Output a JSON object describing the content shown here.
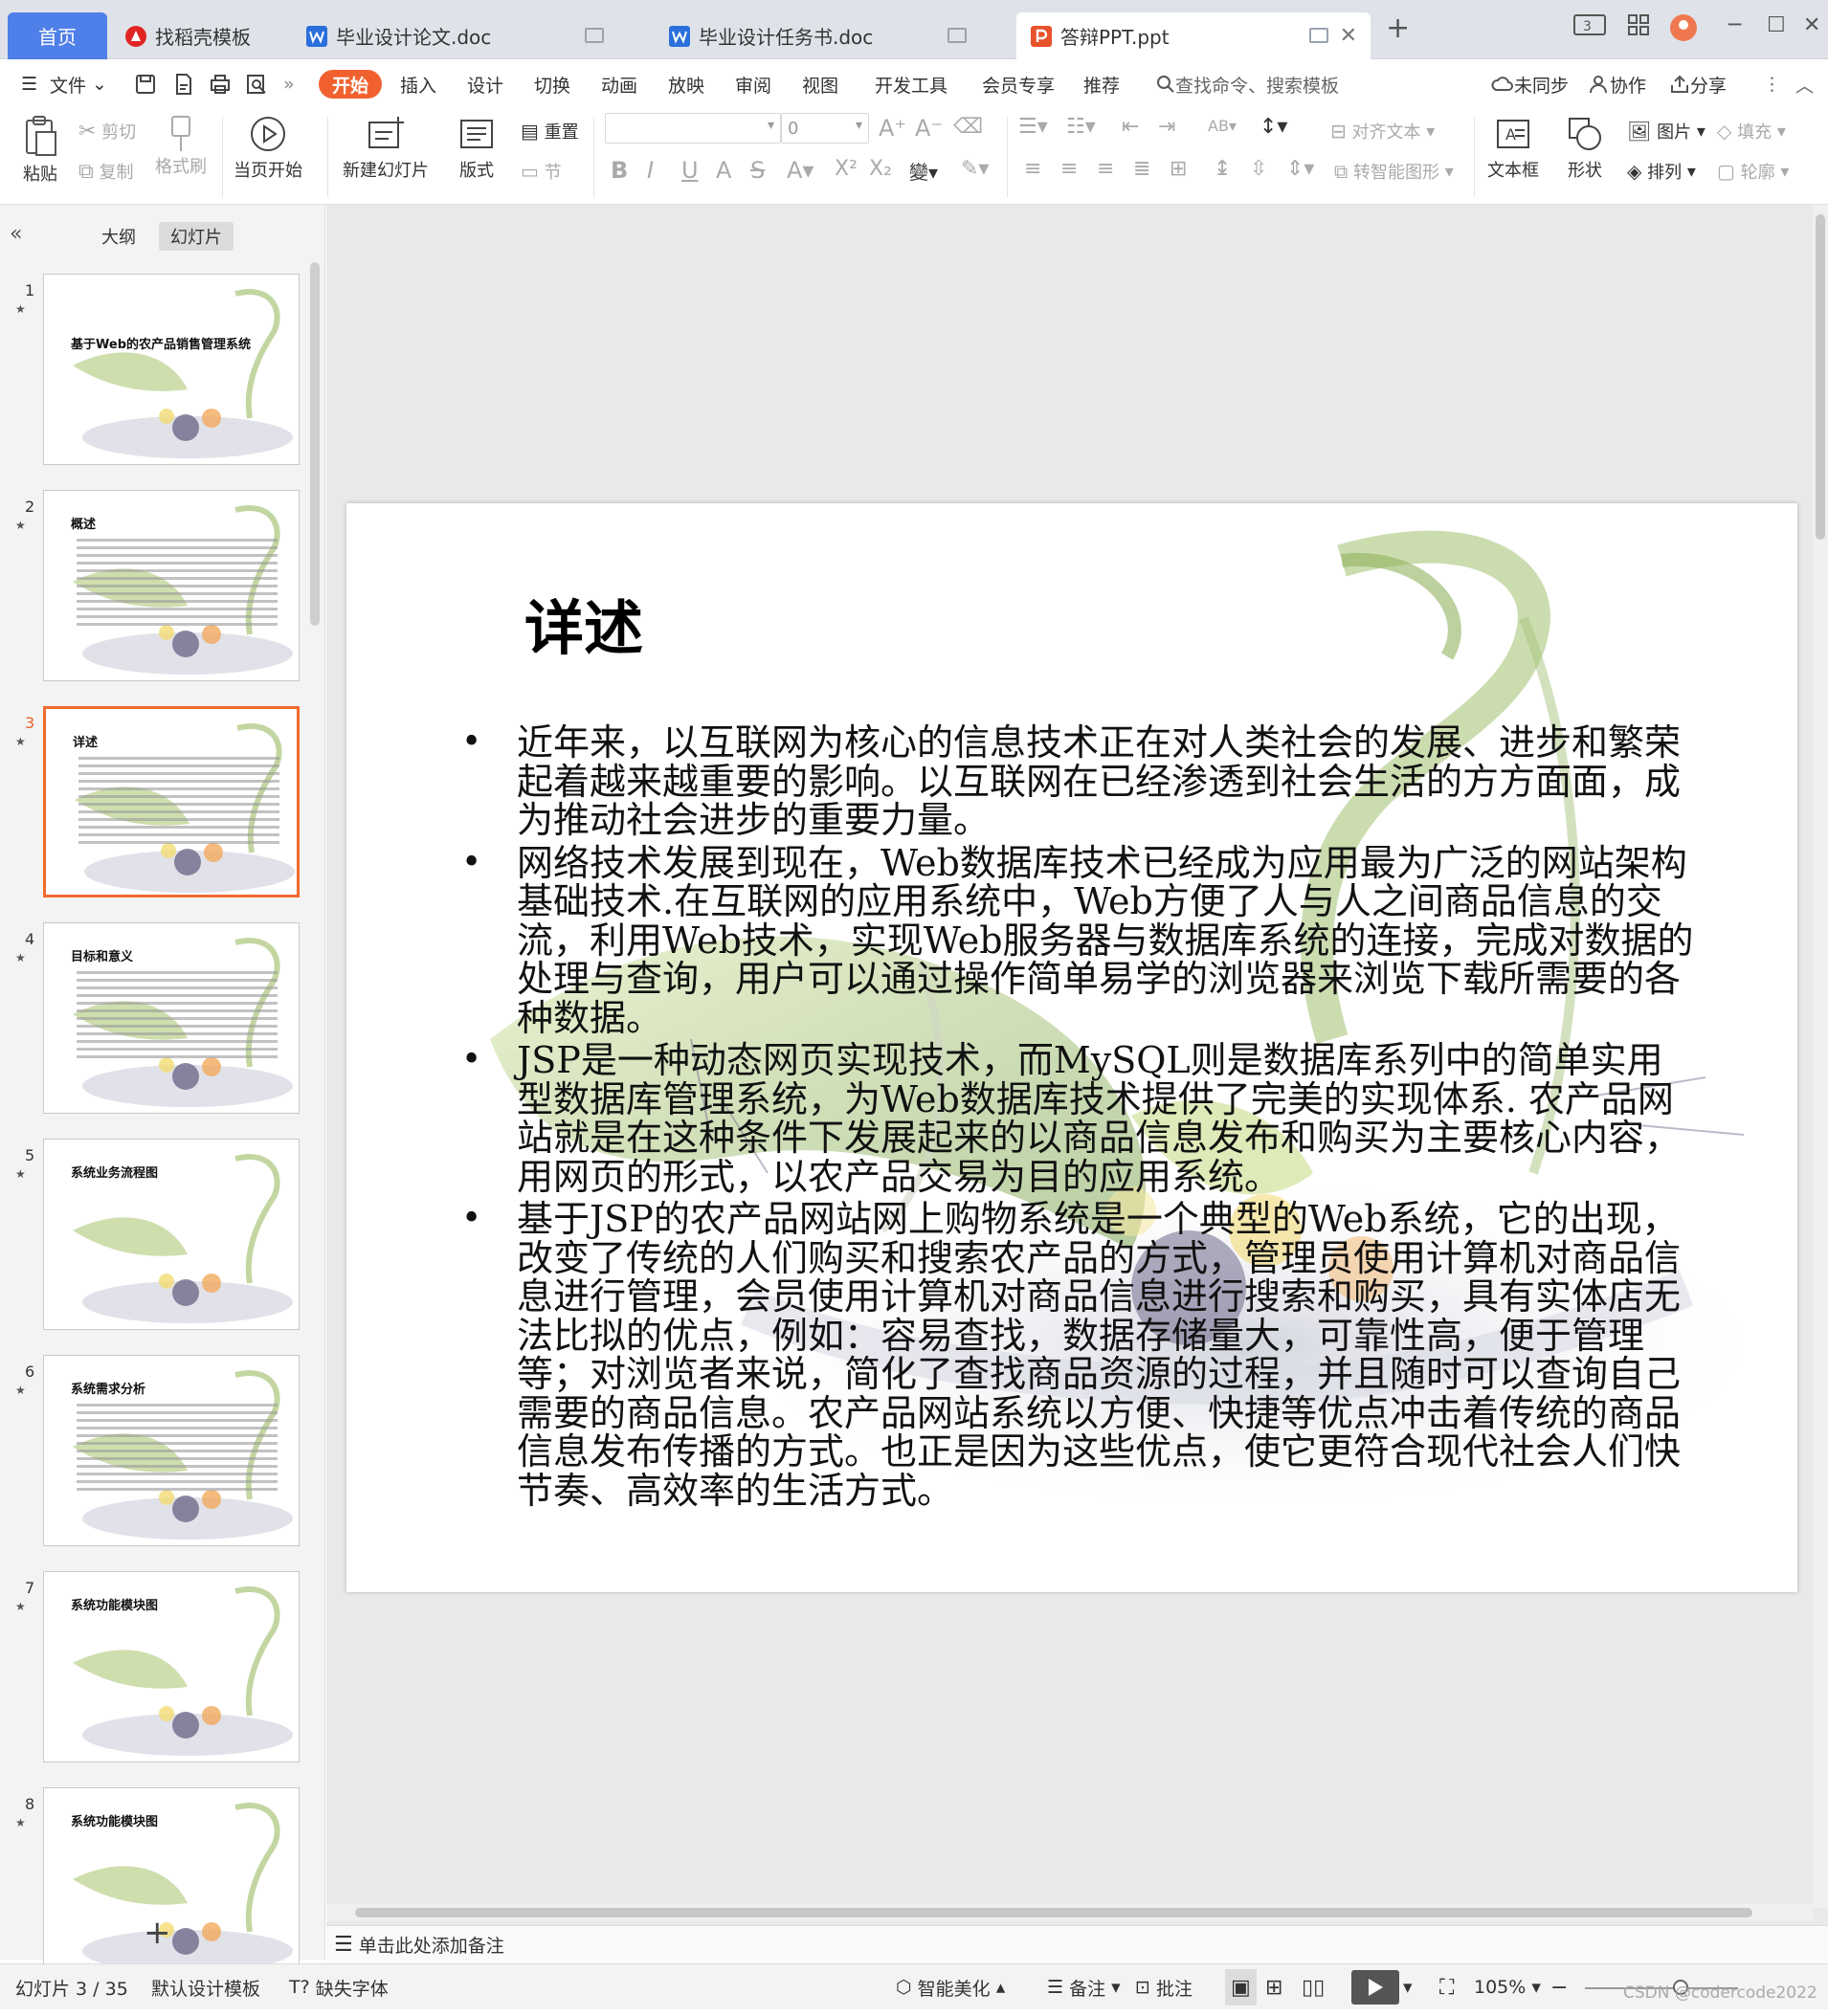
{
  "tabs": [
    {
      "label": "首页",
      "kind": "home"
    },
    {
      "label": "找稻壳模板",
      "kind": "docer"
    },
    {
      "label": "毕业设计论文.doc",
      "kind": "word"
    },
    {
      "label": "毕业设计任务书.doc",
      "kind": "word"
    },
    {
      "label": "答辩PPT.ppt",
      "kind": "ppt",
      "active": true
    }
  ],
  "menu": {
    "file": "文件",
    "items": [
      "开始",
      "插入",
      "设计",
      "切换",
      "动画",
      "放映",
      "审阅",
      "视图",
      "开发工具",
      "会员专享",
      "推荐"
    ],
    "search": "查找命令、搜索模板",
    "sync": "未同步",
    "collab": "协作",
    "share": "分享"
  },
  "ribbon": {
    "paste": "粘贴",
    "cut": "剪切",
    "copy": "复制",
    "format_painter": "格式刷",
    "from_current": "当页开始",
    "new_slide": "新建幻灯片",
    "layout": "版式",
    "reset": "重置",
    "section": "节",
    "font_size": "0",
    "align_text": "对齐文本",
    "smart_graphic": "转智能图形",
    "textbox": "文本框",
    "shape": "形状",
    "picture": "图片",
    "arrange": "排列",
    "fill": "填充",
    "outline": "轮廓"
  },
  "panel": {
    "tab_outline": "大纲",
    "tab_slides": "幻灯片",
    "thumbnails": [
      {
        "num": "1",
        "title": "基于Web的农产品销售管理系统"
      },
      {
        "num": "2",
        "title": "概述"
      },
      {
        "num": "3",
        "title": "详述",
        "current": true
      },
      {
        "num": "4",
        "title": "目标和意义"
      },
      {
        "num": "5",
        "title": "系统业务流程图"
      },
      {
        "num": "6",
        "title": "系统需求分析"
      },
      {
        "num": "7",
        "title": "系统功能模块图"
      },
      {
        "num": "8",
        "title": "系统功能模块图"
      }
    ]
  },
  "slide": {
    "title": "详述",
    "bullets": [
      "近年来，以互联网为核心的信息技术正在对人类社会的发展、进步和繁荣起着越来越重要的影响。以互联网在已经渗透到社会生活的方方面面，成为推动社会进步的重要力量。",
      "网络技术发展到现在，Web数据库技术已经成为应用最为广泛的网站架构基础技术.在互联网的应用系统中，Web方便了人与人之间商品信息的交流，利用Web技术，实现Web服务器与数据库系统的连接，完成对数据的处理与查询，用户可以通过操作简单易学的浏览器来浏览下载所需要的各种数据。",
      "JSP是一种动态网页实现技术，而MySQL则是数据库系列中的简单实用型数据库管理系统，为Web数据库技术提供了完美的实现体系. 农产品网站就是在这种条件下发展起来的以商品信息发布和购买为主要核心内容，用网页的形式，以农产品交易为目的应用系统。",
      "基于JSP的农产品网站网上购物系统是一个典型的Web系统，它的出现，改变了传统的人们购买和搜索农产品的方式，管理员使用计算机对商品信息进行管理，会员使用计算机对商品信息进行搜索和购买，具有实体店无法比拟的优点，例如：容易查找，数据存储量大，可靠性高，便于管理等；对浏览者来说，简化了查找商品资源的过程，并且随时可以查询自己需要的商品信息。农产品网站系统以方便、快捷等优点冲击着传统的商品信息发布传播的方式。也正是因为这些优点，使它更符合现代社会人们快节奏、高效率的生活方式。"
    ]
  },
  "notes_placeholder": "单击此处添加备注",
  "status": {
    "slide_count": "幻灯片 3 / 35",
    "template": "默认设计模板",
    "missing_font": "缺失字体",
    "beautify": "智能美化",
    "notes": "备注",
    "comment": "批注",
    "zoom": "105%",
    "watermark": "CSDN @codercode2022"
  },
  "colors": {
    "accent": "#f1612f",
    "home_tab": "#4f7fe8",
    "current_thumb": "#f06a30"
  }
}
